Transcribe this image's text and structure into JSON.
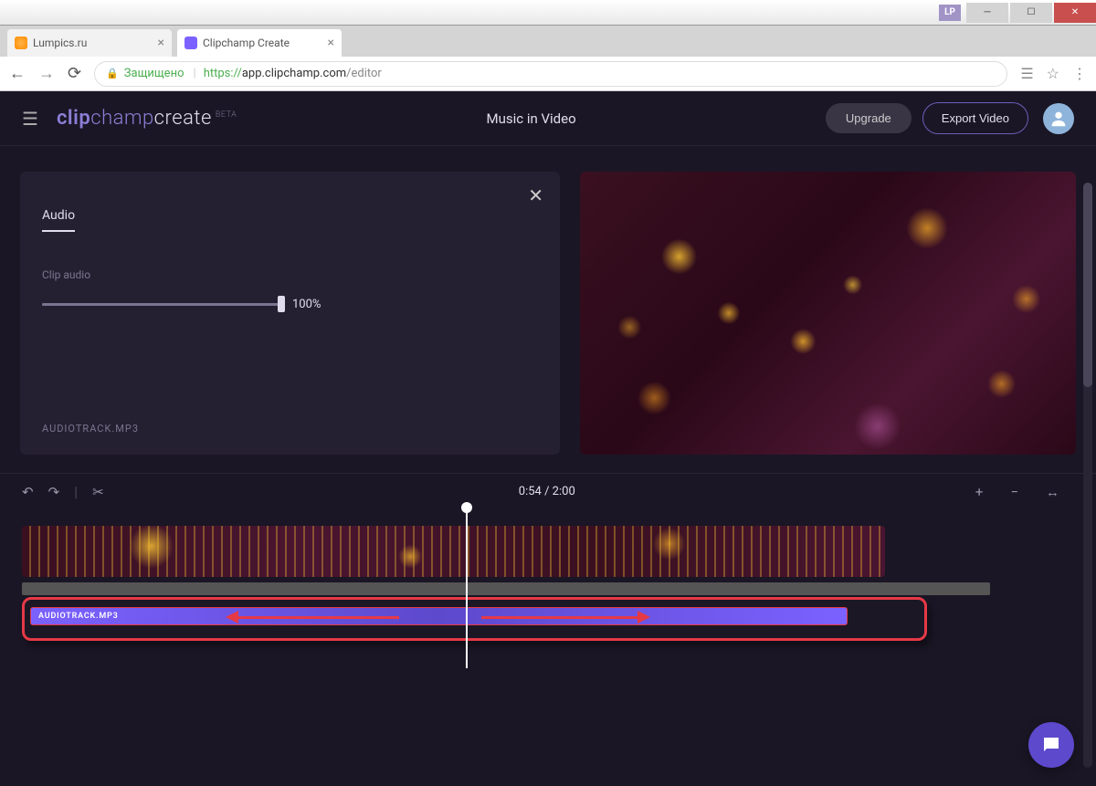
{
  "window": {
    "badge": "LP"
  },
  "browser": {
    "tabs": [
      {
        "title": "Lumpics.ru",
        "active": false
      },
      {
        "title": "Clipchamp Create",
        "active": true
      }
    ],
    "nav": {
      "secure_label": "Защищено",
      "protocol": "https://",
      "domain": "app.clipchamp.com",
      "path": "/editor"
    }
  },
  "app": {
    "logo": {
      "part1": "clip",
      "part2": "champ",
      "part3": "create",
      "tag": "BETA"
    },
    "project_title": "Music in Video",
    "buttons": {
      "upgrade": "Upgrade",
      "export": "Export Video"
    }
  },
  "panel": {
    "tab_label": "Audio",
    "slider_label": "Clip audio",
    "slider_value": "100%",
    "filename": "AUDIOTRACK.MP3"
  },
  "timeline": {
    "time": "0:54 / 2:00",
    "audio_clip_label": "AUDIOTRACK.MP3"
  },
  "colors": {
    "accent": "#7b61ff",
    "annotation": "#e63946",
    "bg_dark": "#1a1625"
  }
}
